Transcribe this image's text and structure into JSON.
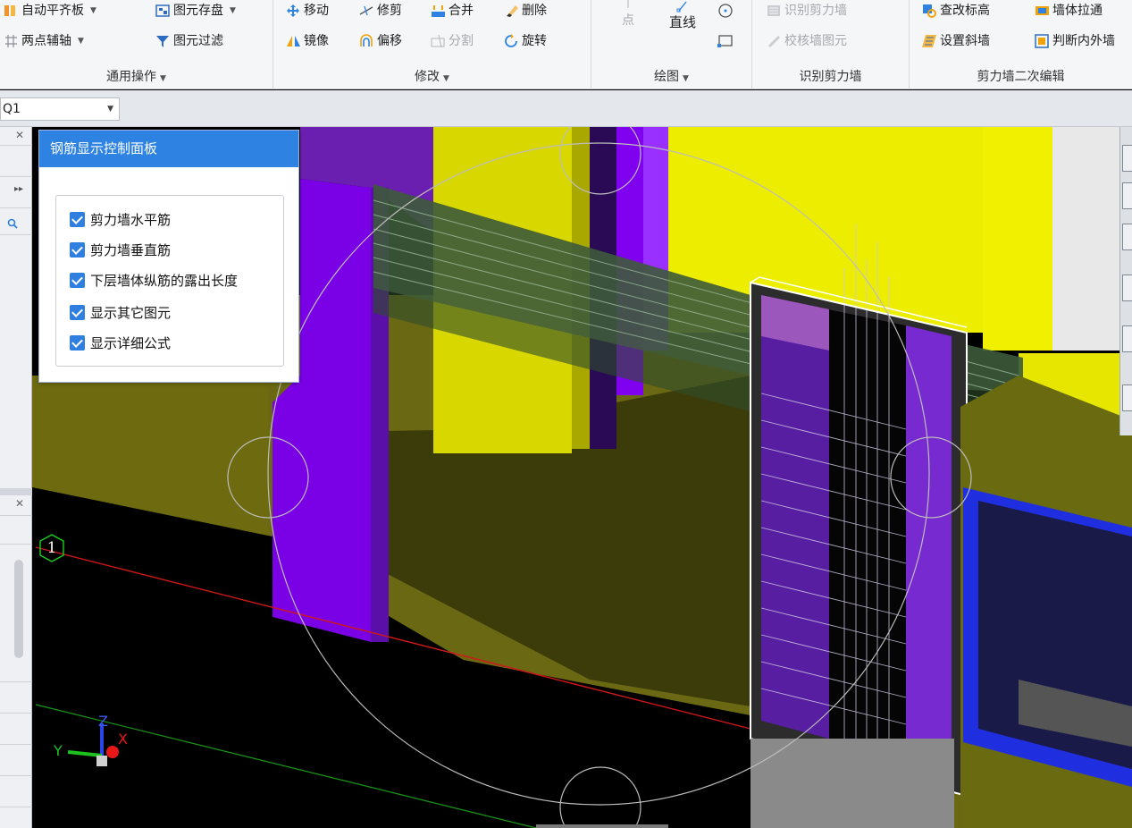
{
  "ribbon": {
    "general": {
      "label": "通用操作",
      "auto_align": "自动平齐板",
      "save_element": "图元存盘",
      "two_point_axis": "两点辅轴",
      "element_filter": "图元过滤"
    },
    "modify": {
      "label": "修改",
      "move": "移动",
      "trim": "修剪",
      "merge": "合并",
      "delete": "删除",
      "mirror": "镜像",
      "offset": "偏移",
      "split": "分割",
      "rotate": "旋转"
    },
    "draw": {
      "label": "绘图",
      "point": "点",
      "line": "直线"
    },
    "identify": {
      "label": "识别剪力墙",
      "identify_wall": "识别剪力墙",
      "check_wall": "校核墙图元"
    },
    "edit2": {
      "label": "剪力墙二次编辑",
      "check_elevation": "查改标高",
      "wall_stretch": "墙体拉通",
      "set_slope_wall": "设置斜墙",
      "judge_inner_outer": "判断内外墙"
    }
  },
  "toolbar": {
    "layer_value": "Q1"
  },
  "rebar_panel": {
    "title": "钢筋显示控制面板",
    "options": [
      {
        "label": "剪力墙水平筋",
        "checked": true
      },
      {
        "label": "剪力墙垂直筋",
        "checked": true
      },
      {
        "label": "下层墙体纵筋的露出长度",
        "checked": true
      },
      {
        "label": "显示其它图元",
        "checked": true
      },
      {
        "label": "显示详细公式",
        "checked": true
      }
    ]
  },
  "viewport": {
    "axis_number": "1",
    "axis_x": "X",
    "axis_y": "Y",
    "axis_z": "Z"
  },
  "colors": {
    "accent": "#2d82e2",
    "wall_purple": "#7a00e6",
    "wall_yellow": "#e6e600",
    "slab_olive": "#6b6b10",
    "window_blue": "#1f2fe0"
  }
}
